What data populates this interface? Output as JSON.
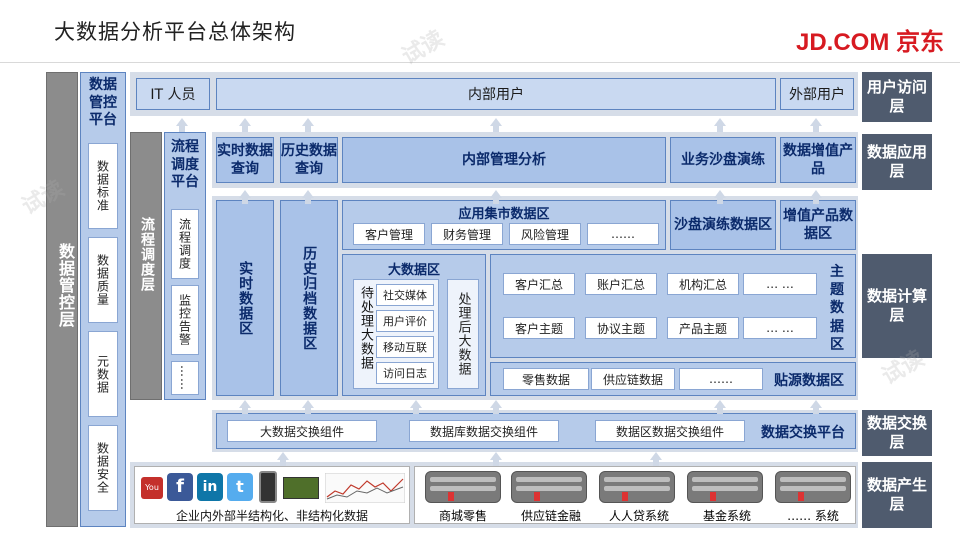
{
  "header": {
    "title": "大数据分析平台总体架构",
    "brand": "JD.COM 京东"
  },
  "layers": {
    "user_access": "用户访问层",
    "data_app": "数据应用层",
    "data_compute": "数据计算层",
    "data_exchange": "数据交换层",
    "data_produce": "数据产生层"
  },
  "left": {
    "data_mgmt_layer": "数据管控层",
    "data_mgmt_platform": "数据管控平台",
    "mgmt_items": [
      "数据标准",
      "数据质量",
      "元数据",
      "数据安全"
    ],
    "flow_layer": "流程调度层",
    "flow_platform": "流程调度平台",
    "flow_items": [
      "流程调度",
      "监控告警",
      "……"
    ]
  },
  "users": {
    "it": "IT 人员",
    "internal": "内部用户",
    "external": "外部用户"
  },
  "apps": {
    "realtime_query": "实时数据查询",
    "history_query": "历史数据查询",
    "internal_analysis": "内部管理分析",
    "sandbox": "业务沙盘演练",
    "value_added": "数据增值产品"
  },
  "compute": {
    "realtime_zone": "实时数据区",
    "history_zone": "历史归档数据区",
    "app_mart": "应用集市数据区",
    "mart_items": [
      "客户管理",
      "财务管理",
      "风险管理",
      "……"
    ],
    "sandbox_zone": "沙盘演练数据区",
    "value_zone": "增值产品数据区",
    "bigdata_zone": "大数据区",
    "pending": "待处理大数据",
    "pending_items": [
      "社交媒体",
      "用户评价",
      "移动互联",
      "访问日志"
    ],
    "processed": "处理后大数据",
    "theme_zone": "主题数据区",
    "theme_row1": [
      "客户汇总",
      "账户汇总",
      "机构汇总",
      "… …"
    ],
    "theme_row2": [
      "客户主题",
      "协议主题",
      "产品主题",
      "… …"
    ],
    "source_zone": "贴源数据区",
    "source_items": [
      "零售数据",
      "供应链数据",
      "……"
    ]
  },
  "exchange": {
    "items": [
      "大数据交换组件",
      "数据库数据交换组件",
      "数据区数据交换组件"
    ],
    "platform": "数据交换平台"
  },
  "produce": {
    "unstructured": "企业内外部半结构化、非结构化数据",
    "social_icons": [
      "You Tube",
      "f",
      "in",
      "t"
    ],
    "systems": [
      "商城零售",
      "供应链金融",
      "人人贷系统",
      "基金系统",
      "…… 系统"
    ]
  },
  "watermark": "试读",
  "colors": {
    "brand": "#d71a21",
    "layer_label": "#4f5b6e",
    "box_blue": "#a9c2e8",
    "band": "#d6dde8"
  }
}
